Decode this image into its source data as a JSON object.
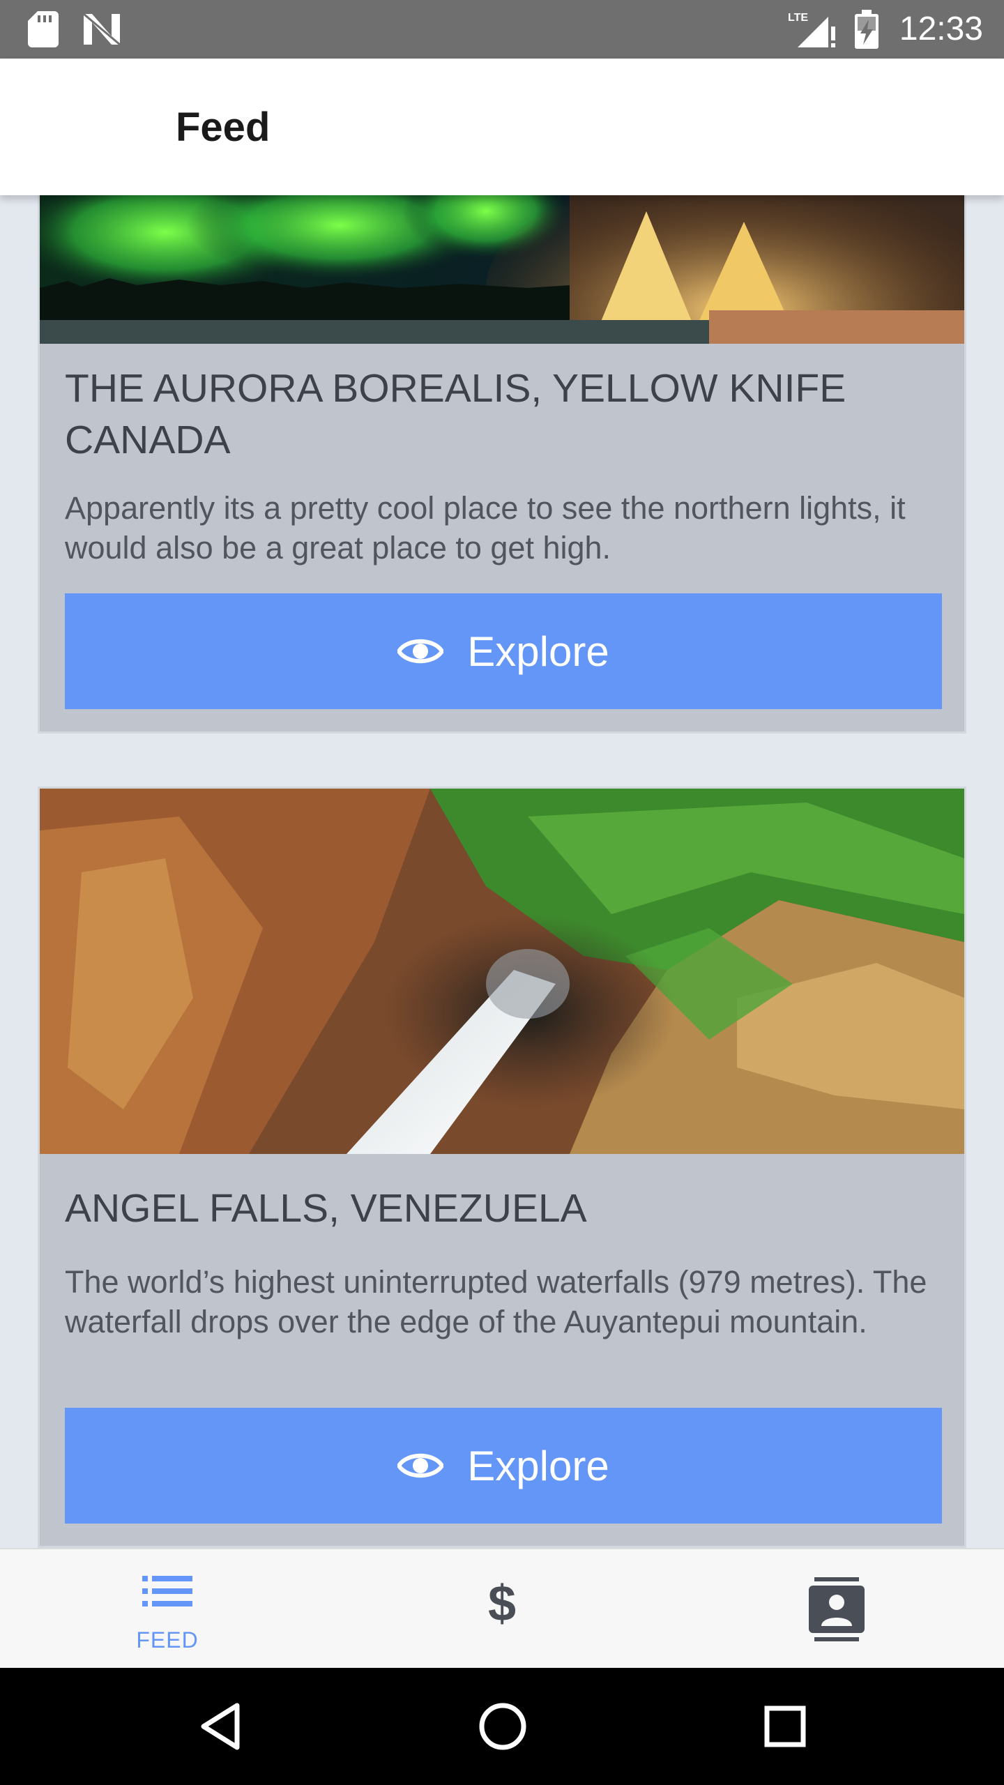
{
  "status_bar": {
    "time": "12:33",
    "network_label": "LTE",
    "icons": [
      "sd-card-icon",
      "n-notification-icon",
      "lte-signal-icon",
      "battery-charging-icon"
    ]
  },
  "app_bar": {
    "title": "Feed"
  },
  "feed": {
    "cards": [
      {
        "image_subject": "aurora-teepee-image",
        "title": "THE AURORA BOREALIS, YELLOW KNIFE CANADA",
        "description": "Apparently its a pretty cool place to see the northern lights, it would also be a great place to get high.",
        "button_label": "Explore"
      },
      {
        "image_subject": "angel-falls-image",
        "title": "ANGEL FALLS, VENEZUELA",
        "description": "The world’s highest uninterrupted waterfalls (979 metres). The waterfall drops over the edge of the Auyantepui mountain.",
        "button_label": "Explore"
      }
    ]
  },
  "bottom_nav": {
    "items": [
      {
        "label": "FEED",
        "icon": "list-icon",
        "active": true
      },
      {
        "label": "",
        "icon": "dollar-icon",
        "active": false
      },
      {
        "label": "",
        "icon": "contact-card-icon",
        "active": false
      }
    ]
  },
  "system_nav": {
    "icons": [
      "back-icon",
      "home-icon",
      "recents-icon"
    ]
  },
  "colors": {
    "status_bar": "#6f6f6f",
    "accent": "#6396f7",
    "card": "#bfc4cd",
    "background": "#e3e7ee"
  }
}
